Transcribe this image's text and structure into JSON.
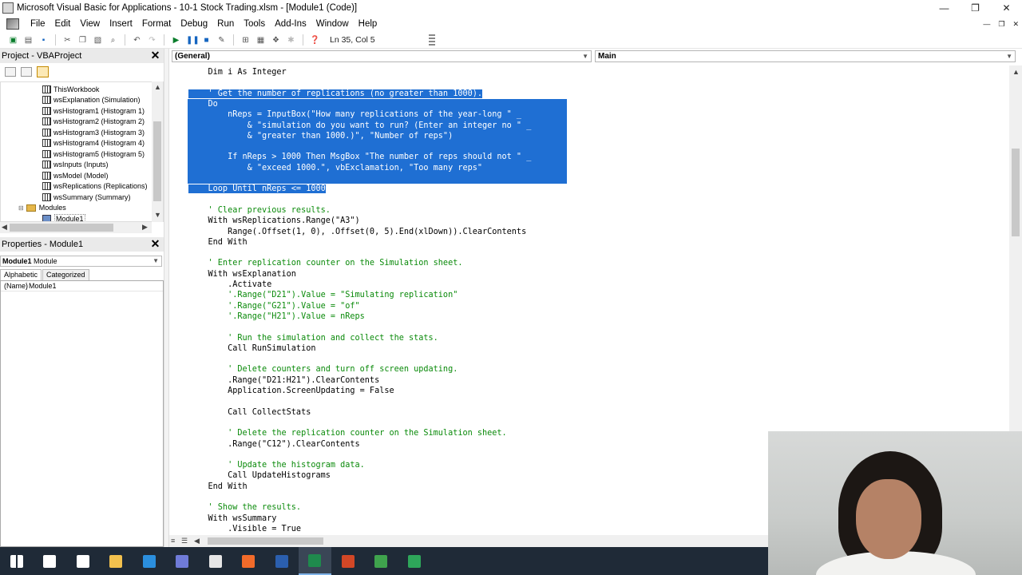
{
  "window": {
    "title": "Microsoft Visual Basic for Applications - 10-1 Stock Trading.xlsm - [Module1 (Code)]",
    "minimize": "—",
    "restore": "❐",
    "close": "✕"
  },
  "menu": {
    "items": [
      "File",
      "Edit",
      "View",
      "Insert",
      "Format",
      "Debug",
      "Run",
      "Tools",
      "Add-Ins",
      "Window",
      "Help"
    ],
    "mdi_minimize": "—",
    "mdi_restore": "❐",
    "mdi_close": "✕"
  },
  "toolbar": {
    "cursor_position": "Ln 35, Col 5"
  },
  "project_panel": {
    "title": "Project - VBAProject",
    "tree": [
      {
        "label": "ThisWorkbook",
        "type": "sheet"
      },
      {
        "label": "wsExplanation (Simulation)",
        "type": "sheet"
      },
      {
        "label": "wsHistogram1 (Histogram 1)",
        "type": "sheet"
      },
      {
        "label": "wsHistogram2 (Histogram 2)",
        "type": "sheet"
      },
      {
        "label": "wsHistogram3 (Histogram 3)",
        "type": "sheet"
      },
      {
        "label": "wsHistogram4 (Histogram 4)",
        "type": "sheet"
      },
      {
        "label": "wsHistogram5 (Histogram 5)",
        "type": "sheet"
      },
      {
        "label": "wsInputs (Inputs)",
        "type": "sheet"
      },
      {
        "label": "wsModel (Model)",
        "type": "sheet"
      },
      {
        "label": "wsReplications (Replications)",
        "type": "sheet"
      },
      {
        "label": "wsSummary (Summary)",
        "type": "sheet"
      },
      {
        "label": "Modules",
        "type": "folder"
      },
      {
        "label": "Module1",
        "type": "module"
      }
    ]
  },
  "properties_panel": {
    "title": "Properties - Module1",
    "object_name": "Module1",
    "object_type": "Module",
    "tab_alphabetic": "Alphabetic",
    "tab_categorized": "Categorized",
    "rows": [
      {
        "key": "(Name)",
        "value": "Module1"
      }
    ]
  },
  "code_window": {
    "object_combo": "(General)",
    "proc_combo": "Main",
    "lines": [
      {
        "text": "    Dim i As Integer",
        "sel": false,
        "comment": false
      },
      {
        "text": "",
        "sel": false,
        "comment": false
      },
      {
        "text": "    ' Get the number of replications (no greater than 1000).",
        "sel": true,
        "comment": true
      },
      {
        "text": "    Do",
        "sel": true,
        "comment": false
      },
      {
        "text": "        nReps = InputBox(\"How many replications of the year-long \" _",
        "sel": true,
        "comment": false
      },
      {
        "text": "            & \"simulation do you want to run? (Enter an integer no \" _",
        "sel": true,
        "comment": false
      },
      {
        "text": "            & \"greater than 1000.)\", \"Number of reps\")",
        "sel": true,
        "comment": false
      },
      {
        "text": "",
        "sel": true,
        "comment": false
      },
      {
        "text": "        If nReps > 1000 Then MsgBox \"The number of reps should not \" _",
        "sel": true,
        "comment": false
      },
      {
        "text": "            & \"exceed 1000.\", vbExclamation, \"Too many reps\"",
        "sel": true,
        "comment": false
      },
      {
        "text": "",
        "sel": true,
        "comment": false
      },
      {
        "text": "    Loop Until nReps <= 1000",
        "sel": true,
        "comment": false
      },
      {
        "text": "",
        "sel": false,
        "comment": false
      },
      {
        "text": "    ' Clear previous results.",
        "sel": false,
        "comment": true
      },
      {
        "text": "    With wsReplications.Range(\"A3\")",
        "sel": false,
        "comment": false
      },
      {
        "text": "        Range(.Offset(1, 0), .Offset(0, 5).End(xlDown)).ClearContents",
        "sel": false,
        "comment": false
      },
      {
        "text": "    End With",
        "sel": false,
        "comment": false
      },
      {
        "text": "",
        "sel": false,
        "comment": false
      },
      {
        "text": "    ' Enter replication counter on the Simulation sheet.",
        "sel": false,
        "comment": true
      },
      {
        "text": "    With wsExplanation",
        "sel": false,
        "comment": false
      },
      {
        "text": "        .Activate",
        "sel": false,
        "comment": false
      },
      {
        "text": "        '.Range(\"D21\").Value = \"Simulating replication\"",
        "sel": false,
        "comment": true
      },
      {
        "text": "        '.Range(\"G21\").Value = \"of\"",
        "sel": false,
        "comment": true
      },
      {
        "text": "        '.Range(\"H21\").Value = nReps",
        "sel": false,
        "comment": true
      },
      {
        "text": "",
        "sel": false,
        "comment": false
      },
      {
        "text": "        ' Run the simulation and collect the stats.",
        "sel": false,
        "comment": true
      },
      {
        "text": "        Call RunSimulation",
        "sel": false,
        "comment": false
      },
      {
        "text": "",
        "sel": false,
        "comment": false
      },
      {
        "text": "        ' Delete counters and turn off screen updating.",
        "sel": false,
        "comment": true
      },
      {
        "text": "        .Range(\"D21:H21\").ClearContents",
        "sel": false,
        "comment": false
      },
      {
        "text": "        Application.ScreenUpdating = False",
        "sel": false,
        "comment": false
      },
      {
        "text": "",
        "sel": false,
        "comment": false
      },
      {
        "text": "        Call CollectStats",
        "sel": false,
        "comment": false
      },
      {
        "text": "",
        "sel": false,
        "comment": false
      },
      {
        "text": "        ' Delete the replication counter on the Simulation sheet.",
        "sel": false,
        "comment": true
      },
      {
        "text": "        .Range(\"C12\").ClearContents",
        "sel": false,
        "comment": false
      },
      {
        "text": "",
        "sel": false,
        "comment": false
      },
      {
        "text": "        ' Update the histogram data.",
        "sel": false,
        "comment": true
      },
      {
        "text": "        Call UpdateHistograms",
        "sel": false,
        "comment": false
      },
      {
        "text": "    End With",
        "sel": false,
        "comment": false
      },
      {
        "text": "",
        "sel": false,
        "comment": false
      },
      {
        "text": "    ' Show the results.",
        "sel": false,
        "comment": true
      },
      {
        "text": "    With wsSummary",
        "sel": false,
        "comment": false
      },
      {
        "text": "        .Visible = True",
        "sel": false,
        "comment": false
      }
    ]
  },
  "taskbar": {
    "items": [
      {
        "name": "start",
        "color": "#ffffff"
      },
      {
        "name": "task-view",
        "color": "#ffffff"
      },
      {
        "name": "file",
        "color": "#ffffff"
      },
      {
        "name": "file-explorer",
        "color": "#f2c14e"
      },
      {
        "name": "edge",
        "color": "#2b8fde"
      },
      {
        "name": "discord",
        "color": "#6f7bd8"
      },
      {
        "name": "calculator",
        "color": "#e6e6e6"
      },
      {
        "name": "firefox",
        "color": "#f26b2a"
      },
      {
        "name": "word",
        "color": "#2b5fae"
      },
      {
        "name": "excel",
        "color": "#1f8a4d"
      },
      {
        "name": "powerpoint",
        "color": "#d24726"
      },
      {
        "name": "chrome",
        "color": "#3fa34d"
      },
      {
        "name": "excel-alt",
        "color": "#2ea65a"
      }
    ]
  },
  "colors": {
    "selection": "#1f6fd3",
    "comment": "#0a8a0a",
    "keyword": "#00008b"
  }
}
